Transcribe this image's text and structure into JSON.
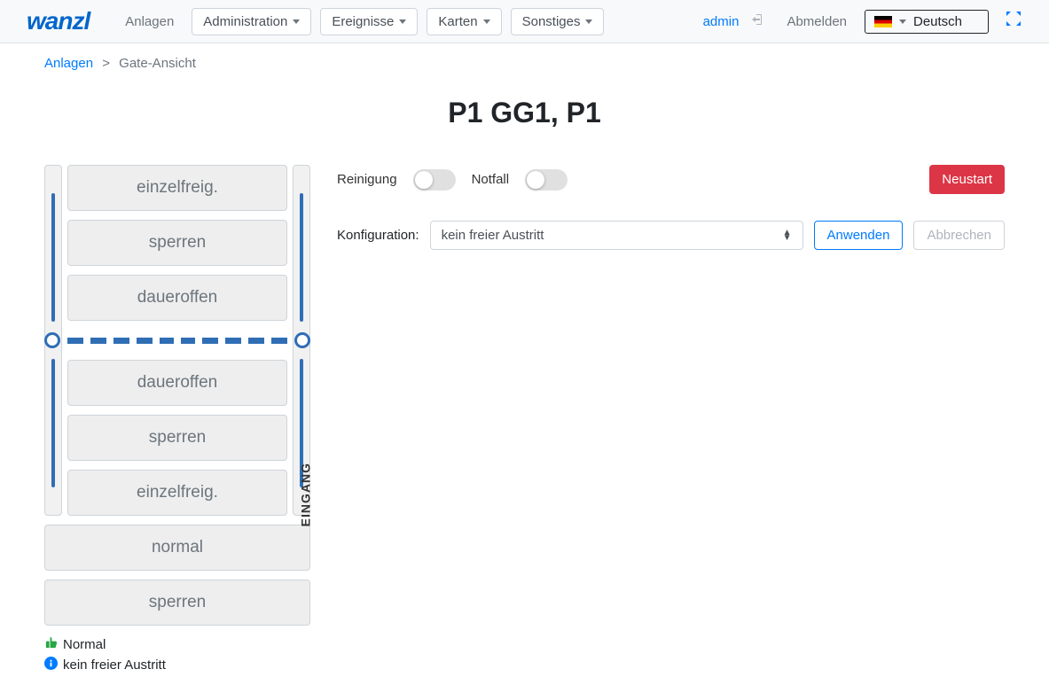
{
  "header": {
    "logo": "wanzl",
    "nav": {
      "anlagen": "Anlagen",
      "administration": "Administration",
      "ereignisse": "Ereignisse",
      "karten": "Karten",
      "sonstiges": "Sonstiges"
    },
    "admin_link": "admin",
    "logout": "Abmelden",
    "language": "Deutsch"
  },
  "breadcrumb": {
    "root": "Anlagen",
    "sep": ">",
    "current": "Gate-Ansicht"
  },
  "title": "P1 GG1, P1",
  "gate": {
    "buttons_top": {
      "b1": "einzelfreig.",
      "b2": "sperren",
      "b3": "daueroffen"
    },
    "buttons_bottom": {
      "b1": "daueroffen",
      "b2": "sperren",
      "b3": "einzelfreig."
    },
    "eingang": "EINGANG",
    "wide": {
      "b1": "normal",
      "b2": "sperren"
    }
  },
  "status": {
    "normal": "Normal",
    "info": "kein freier Austritt"
  },
  "controls": {
    "reinigung": "Reinigung",
    "notfall": "Notfall",
    "neustart": "Neustart",
    "konfiguration": "Konfiguration:",
    "config_value": "kein freier Austritt",
    "anwenden": "Anwenden",
    "abbrechen": "Abbrechen"
  }
}
